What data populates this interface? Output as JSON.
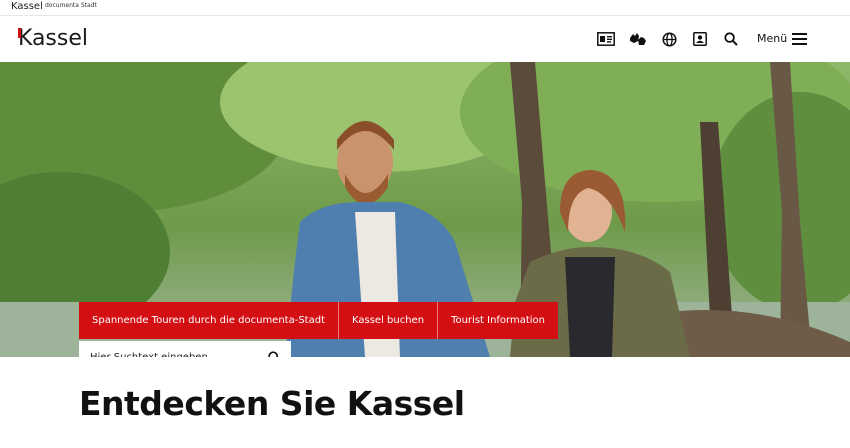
{
  "topbar": {
    "brand": "Kassel",
    "tagline": "documenta Stadt"
  },
  "header": {
    "logo": {
      "first_letter": "K",
      "rest": "assel"
    },
    "tools": [
      {
        "icon": "id-card-icon"
      },
      {
        "icon": "sign-language-icon"
      },
      {
        "icon": "globe-icon"
      },
      {
        "icon": "contact-icon"
      },
      {
        "icon": "search-icon"
      }
    ],
    "menu_label": "Menü"
  },
  "hero": {
    "quicklinks": [
      "Spannende Touren durch die documenta-Stadt",
      "Kassel buchen",
      "Tourist Information"
    ],
    "search": {
      "placeholder": "Hier Suchtext eingeben",
      "value": ""
    },
    "slider": {
      "count": 6,
      "active_index": 1
    }
  },
  "main": {
    "headline": "Entdecken Sie Kassel"
  },
  "colors": {
    "accent": "#d40f14"
  }
}
